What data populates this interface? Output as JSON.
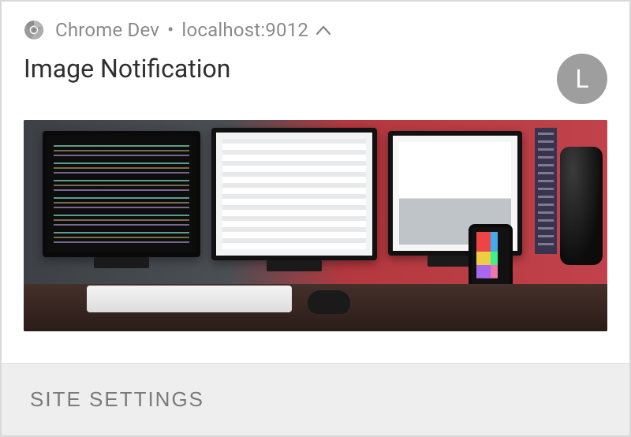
{
  "source": {
    "app": "Chrome Dev",
    "separator": "•",
    "host": "localhost:9012"
  },
  "notification": {
    "title": "Image Notification",
    "avatar_letter": "L",
    "image_alt": "desk with two code monitors, a white-screen monitor, phone, keyboard and black cylinder"
  },
  "actions": {
    "site_settings": "SITE SETTINGS"
  }
}
